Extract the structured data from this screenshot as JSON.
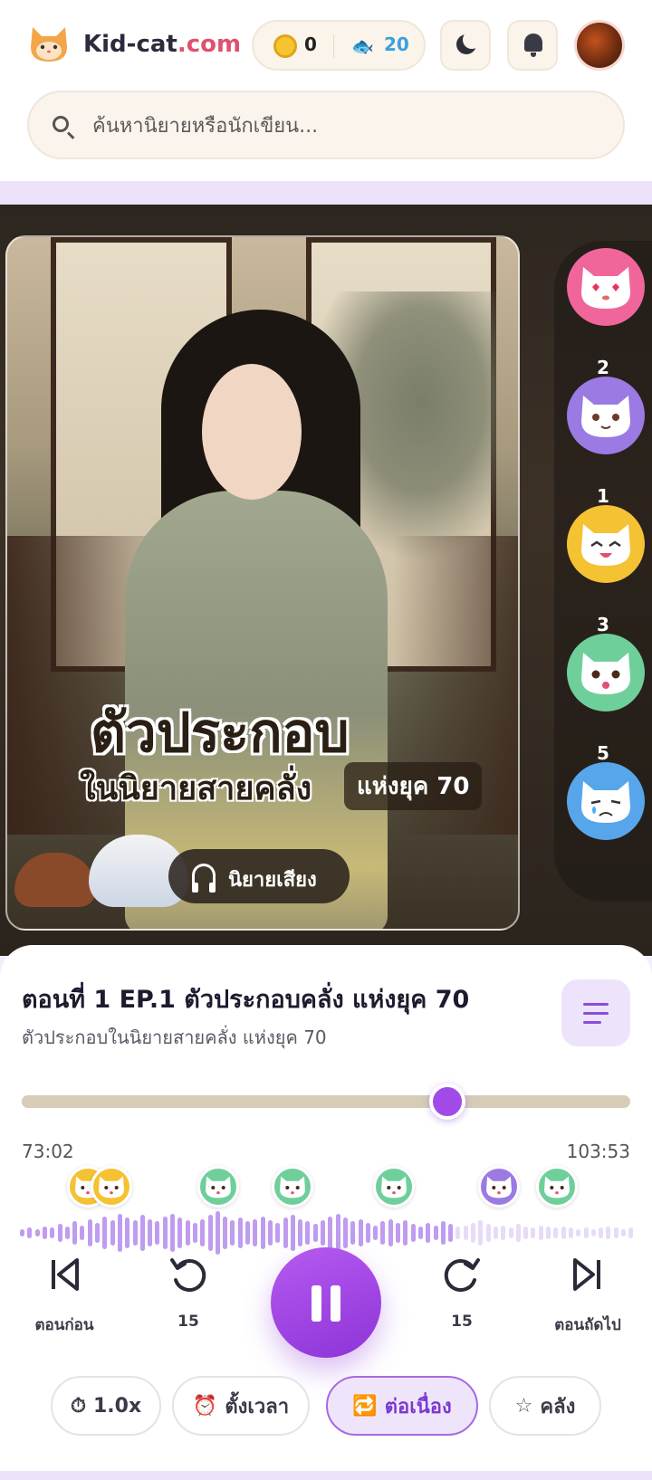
{
  "header": {
    "logo_text_main": "Kid-cat",
    "logo_text_suffix": ".com",
    "coins": "0",
    "fish": "20"
  },
  "search": {
    "placeholder": "ค้นหานิยายหรือนักเขียน..."
  },
  "cover": {
    "title": "ตัวประกอบ",
    "subtitle": "ในนิยายสายคลั่ง",
    "subtitle_tag": "แห่งยุค 70",
    "audio_label": "นิยายเสียง"
  },
  "reactions": [
    {
      "name": "heart-eyes",
      "count": "2",
      "bg": "#f0669b"
    },
    {
      "name": "happy-tears",
      "count": "1",
      "bg": "#9b7ae4"
    },
    {
      "name": "laughing",
      "count": "3",
      "bg": "#f5c233"
    },
    {
      "name": "surprised",
      "count": "5",
      "bg": "#6fcf9b"
    },
    {
      "name": "crying",
      "count": "",
      "bg": "#57a6ec"
    }
  ],
  "player": {
    "episode_title": "ตอนที่ 1 EP.1 ตัวประกอบคลั่ง แห่งยุค 70",
    "episode_subtitle": "ตัวประกอบในนิยายสายคลั่ง แห่งยุค 70",
    "progress": 0.7,
    "time_current": "73:02",
    "time_total": "103:53",
    "prev_label": "ตอนก่อน",
    "rewind_label": "15",
    "forward_label": "15",
    "next_label": "ตอนถัดไป",
    "accent": "#a24ae8"
  },
  "chips": {
    "speed": "1.0x",
    "timer": "ตั้งเวลา",
    "continuous": "ต่อเนื่อง",
    "library": "คลัง"
  }
}
